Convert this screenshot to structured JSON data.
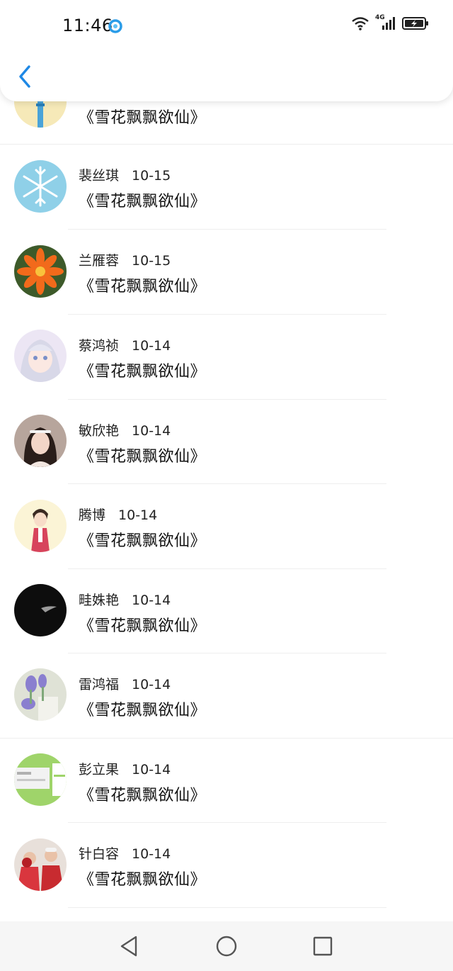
{
  "status_bar": {
    "time": "11:46",
    "network": "4G"
  },
  "header": {
    "back_icon": "chevron-left-icon"
  },
  "partial_row": {
    "title": "《雪花飘飘欲仙》"
  },
  "rows": [
    {
      "name": "裴丝琪",
      "date": "10-15",
      "title": "《雪花飘飘欲仙》"
    },
    {
      "name": "兰雁蓉",
      "date": "10-15",
      "title": "《雪花飘飘欲仙》"
    },
    {
      "name": "蔡鸿祯",
      "date": "10-14",
      "title": "《雪花飘飘欲仙》"
    },
    {
      "name": "敏欣艳",
      "date": "10-14",
      "title": "《雪花飘飘欲仙》"
    },
    {
      "name": "腾博",
      "date": "10-14",
      "title": "《雪花飘飘欲仙》"
    },
    {
      "name": "畦姝艳",
      "date": "10-14",
      "title": "《雪花飘飘欲仙》"
    },
    {
      "name": "雷鸿福",
      "date": "10-14",
      "title": "《雪花飘飘欲仙》"
    },
    {
      "name": "彭立果",
      "date": "10-14",
      "title": "《雪花飘飘欲仙》"
    },
    {
      "name": "针白容",
      "date": "10-14",
      "title": "《雪花飘飘欲仙》"
    }
  ],
  "navbar": {
    "back": "triangle-back-icon",
    "home": "circle-home-icon",
    "recents": "square-recents-icon"
  },
  "colors": {
    "accent": "#1e88e5",
    "divider": "#eeeeee"
  }
}
